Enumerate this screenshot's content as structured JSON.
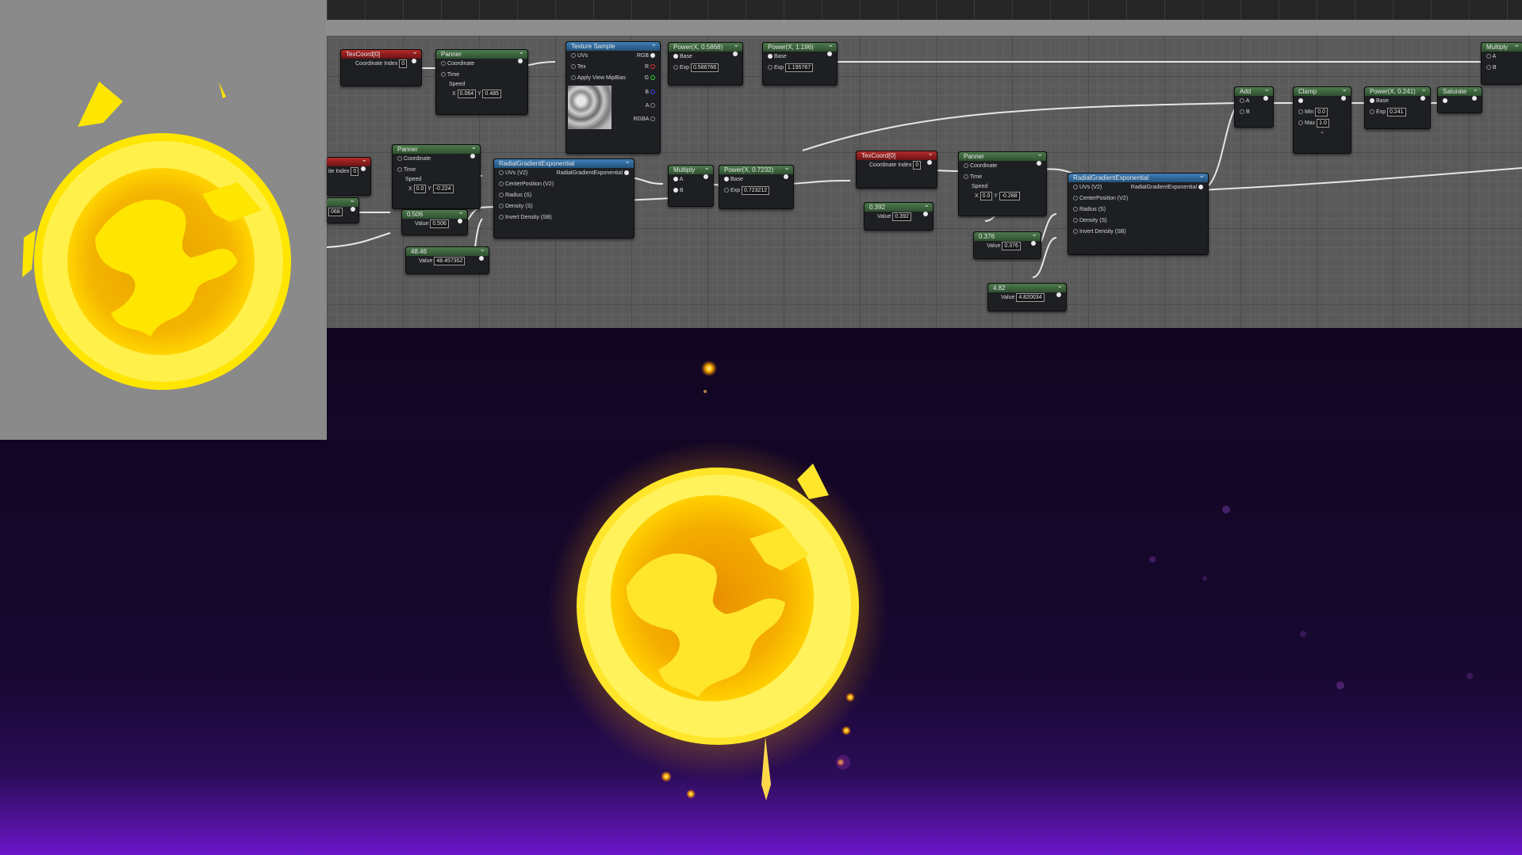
{
  "nodes": {
    "texcoord_1": {
      "title": "TexCoord[0]",
      "coord_label": "Coordinate Index",
      "coord_value": "0"
    },
    "panner_1": {
      "title": "Panner",
      "coordinate": "Coordinate",
      "time": "Time",
      "speed": "Speed",
      "x_label": "X",
      "x_value": "0.064",
      "y_label": "Y",
      "y_value": "0.485"
    },
    "texture_sample": {
      "title": "Texture Sample",
      "uvs": "UVs",
      "tex": "Tex",
      "apply_mip": "Apply View MipBias",
      "rgb": "RGB",
      "r": "R",
      "g": "G",
      "b": "B",
      "a": "A",
      "rgba": "RGBA"
    },
    "power_1": {
      "title": "Power(X, 0.5868)",
      "base": "Base",
      "exp_label": "Exp",
      "exp_value": "0.586766"
    },
    "power_2": {
      "title": "Power(X, 1.196)",
      "base": "Base",
      "exp_label": "Exp",
      "exp_value": "1.195767"
    },
    "multiply_right": {
      "title": "Multiply",
      "a": "A",
      "b": "B"
    },
    "texcoord_left_partial": {
      "coord_label": "ite Index",
      "coord_value": "0"
    },
    "partial_value": {
      "value": "068"
    },
    "panner_2": {
      "title": "Panner",
      "coordinate": "Coordinate",
      "time": "Time",
      "speed": "Speed",
      "x_label": "X",
      "x_value": "0.0",
      "y_label": "Y",
      "y_value": "-0.224"
    },
    "const_0506": {
      "title": "0.506",
      "value_label": "Value",
      "value": "0.506"
    },
    "const_4846": {
      "title": "48.46",
      "value_label": "Value",
      "value": "48.457352"
    },
    "radial_1": {
      "title": "RadialGradientExponential",
      "uvs": "UVs (V2)",
      "center": "CenterPosition (V2)",
      "radius": "Radius (S)",
      "density": "Density (S)",
      "invert": "Invert Density (SB)",
      "out": "RadialGradientExponential"
    },
    "multiply_1": {
      "title": "Multiply",
      "a": "A",
      "b": "B"
    },
    "power_3": {
      "title": "Power(X, 0.7232)",
      "base": "Base",
      "exp_label": "Exp",
      "exp_value": "0.723212"
    },
    "texcoord_2": {
      "title": "TexCoord[0]",
      "coord_label": "Coordinate Index",
      "coord_value": "0"
    },
    "const_0392": {
      "title": "0.392",
      "value_label": "Value",
      "value": "0.392"
    },
    "panner_3": {
      "title": "Panner",
      "coordinate": "Coordinate",
      "time": "Time",
      "speed": "Speed",
      "x_label": "X",
      "x_value": "0.0",
      "y_label": "Y",
      "y_value": "-0.288"
    },
    "const_0376": {
      "title": "0.376",
      "value_label": "Value",
      "value": "0.376"
    },
    "const_482": {
      "title": "4.82",
      "value_label": "Value",
      "value": "4.820034"
    },
    "radial_2": {
      "title": "RadialGradientExponential",
      "uvs": "UVs (V2)",
      "center": "CenterPosition (V2)",
      "radius": "Radius (S)",
      "density": "Density (S)",
      "invert": "Invert Density (SB)",
      "out": "RadialGradientExponential"
    },
    "add": {
      "title": "Add",
      "a": "A",
      "b": "B"
    },
    "clamp": {
      "title": "Clamp",
      "min_label": "Min",
      "min_value": "0.0",
      "max_label": "Max",
      "max_value": "1.0"
    },
    "power_4": {
      "title": "Power(X, 0.241)",
      "base": "Base",
      "exp_label": "Exp",
      "exp_value": "0.241"
    },
    "saturate": {
      "title": "Saturate"
    }
  },
  "colors": {
    "glow_core": "#ffe800",
    "glow_inner": "#f0a000",
    "wire": "#e8e8e8",
    "viewport_bottom": "#6a16c8"
  }
}
